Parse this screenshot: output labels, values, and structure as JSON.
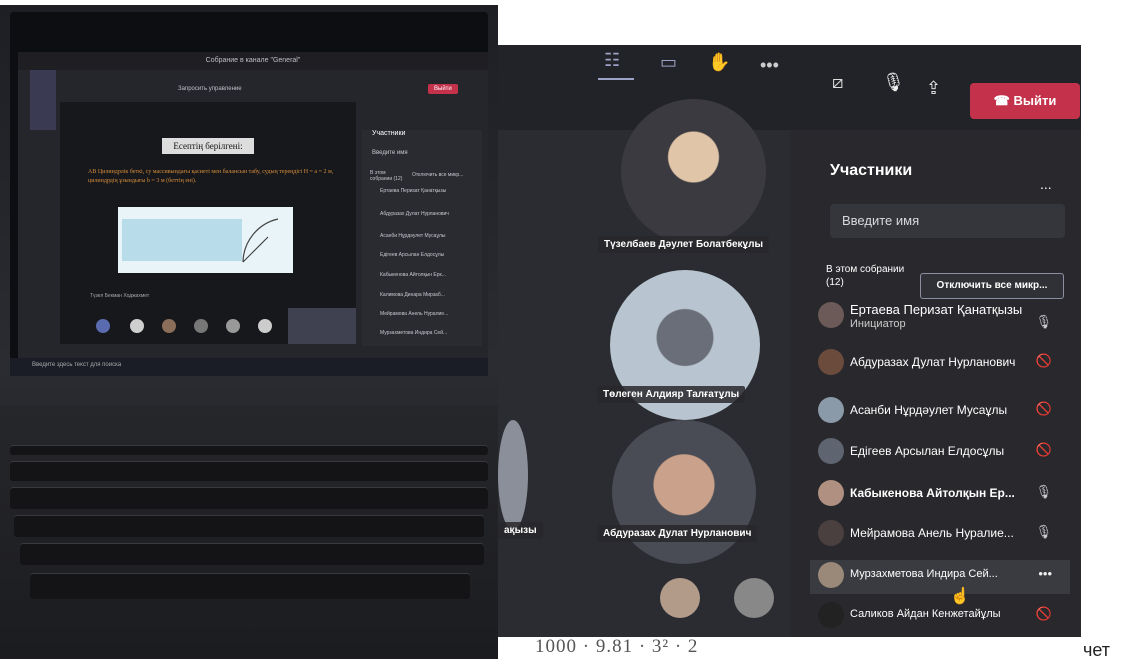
{
  "left_screen": {
    "window_title": "Собрание в канале \"General\"",
    "request_control": "Запросить управление",
    "leave_label": "Выйти",
    "slide_title": "Есептің берілгені:",
    "slide_text": "АВ Цилиндрлік беткі, су массивындағы қасиеті мен балансын табу, судың тереңдігі H = a = 2 м, цилиндрдің ұзындығы b = 3 м (беттің ені).",
    "presenter_name": "Түзел Бекман Ходжахмет",
    "participants_title": "Участники",
    "participants_search": "Введите имя",
    "participants_count": "В этом собрании (12)",
    "mute_all": "Отключить все микр...",
    "mini_list": [
      "Ертаева Перизат Қанатқызы",
      "Абдуразах Дулат Нурланович",
      "Асанби Нұрдәулет Мусаұлы",
      "Едігеев Арсылан Елдосұлы",
      "Кабыкенова Айтолқын Ерк...",
      "Калимова Динара Мирзаб...",
      "Мейрамова Анель Нуралие...",
      "Мурзахметова Индира Сей..."
    ],
    "taskbar_search": "Введите здесь текст для поиска"
  },
  "meeting": {
    "leave_label": "Выйти",
    "panel_title": "Участники",
    "panel_more": "...",
    "search_placeholder": "Введите имя",
    "in_meeting_label": "В этом собрании (12)",
    "mute_all_button": "Отключить все микр...",
    "participants": [
      {
        "name": "Ертаева Перизат Қанатқызы",
        "role": "Инициатор",
        "mic": "on"
      },
      {
        "name": "Абдуразах Дулат Нурланович",
        "mic": "muted"
      },
      {
        "name": "Асанби Нұрдәулет Мусаұлы",
        "mic": "muted"
      },
      {
        "name": "Едігеев Арсылан Елдосұлы",
        "mic": "muted"
      },
      {
        "name": "Кабыкенова Айтолқын Ер...",
        "mic": "on"
      },
      {
        "name": "Мейрамова Анель Нуралие...",
        "mic": "on"
      },
      {
        "name": "Мурзахметова Индира Сей...",
        "mic": "more"
      },
      {
        "name": "Саликов Айдан Кенжетайұлы",
        "mic": "muted"
      }
    ],
    "video_tiles": [
      {
        "name": "Түзелбаев Дәулет Болатбекұлы"
      },
      {
        "name": "Төлеген Алдияр Талғатұлы"
      },
      {
        "name": "Абдуразах Дулат Нурланович"
      },
      {
        "name": "ақызы"
      }
    ]
  },
  "formula": "1000 · 9.81 · 3² · 2",
  "trailing_text": "чет",
  "colors": {
    "leave_red": "#c4314b",
    "panel_bg": "#29292d",
    "bar_bg": "#222328",
    "icon_accent": "#9da2c7"
  }
}
